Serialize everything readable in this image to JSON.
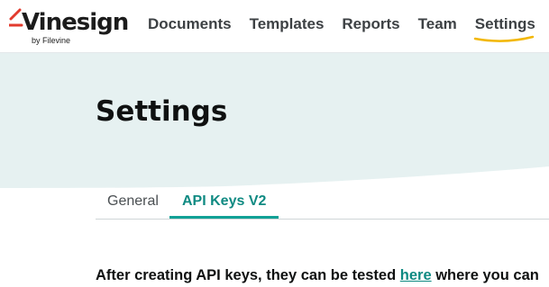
{
  "brand": {
    "name": "Vinesign",
    "subtitle": "by Filevine",
    "accent_color": "#e23b2e",
    "underline_color": "#f2b705"
  },
  "nav": {
    "items": [
      {
        "label": "Documents",
        "active": false
      },
      {
        "label": "Templates",
        "active": false
      },
      {
        "label": "Reports",
        "active": false
      },
      {
        "label": "Team",
        "active": false
      },
      {
        "label": "Settings",
        "active": true
      }
    ]
  },
  "page": {
    "title": "Settings",
    "hero_color": "#e6f1f1"
  },
  "tabs": [
    {
      "label": "General",
      "active": false
    },
    {
      "label": "API Keys V2",
      "active": true
    }
  ],
  "content": {
    "intro_before": "After creating API keys, they can be tested ",
    "intro_link": "here",
    "intro_after": " where you can"
  },
  "colors": {
    "teal": "#12a196",
    "text": "#0f1111"
  }
}
